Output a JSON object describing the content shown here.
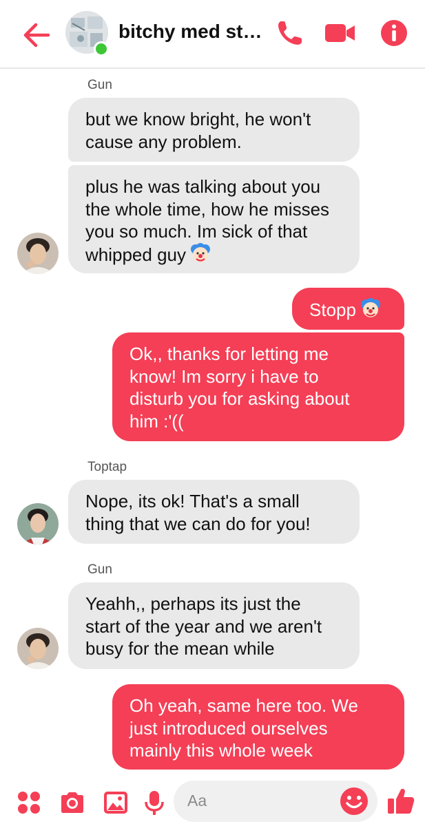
{
  "header": {
    "title": "bitchy med stu...",
    "icons": [
      "back-arrow-icon",
      "phone-icon",
      "video-camera-icon",
      "info-icon"
    ],
    "accent_color": "#f43f56"
  },
  "messages": [
    {
      "sender": "Gun"
    },
    {
      "text": "but we know bright, he won't\ncause any problem."
    },
    {
      "text": "plus he was talking about you\nthe whole time, how he misses\nyou so much. Im sick of that\nwhipped guy"
    },
    {
      "text": "Stopp"
    },
    {
      "text": "Ok,, thanks for letting me\nknow! Im sorry i have to\ndisturb you for asking about\nhim :'(("
    },
    {
      "sender": "Toptap"
    },
    {
      "text": "Nope, its ok! That's a small\nthing that we can do for you!"
    },
    {
      "sender": "Gun"
    },
    {
      "text": "Yeahh,, perhaps its just the\nstart of the year and we aren't\nbusy for the mean while"
    },
    {
      "text": "Oh yeah, same here too. We\njust introduced ourselves\nmainly this whole week"
    }
  ],
  "composer": {
    "placeholder": "Aa",
    "icons": [
      "apps-icon",
      "camera-icon",
      "image-icon",
      "microphone-icon",
      "emoji-icon",
      "thumbs-up-icon"
    ]
  }
}
